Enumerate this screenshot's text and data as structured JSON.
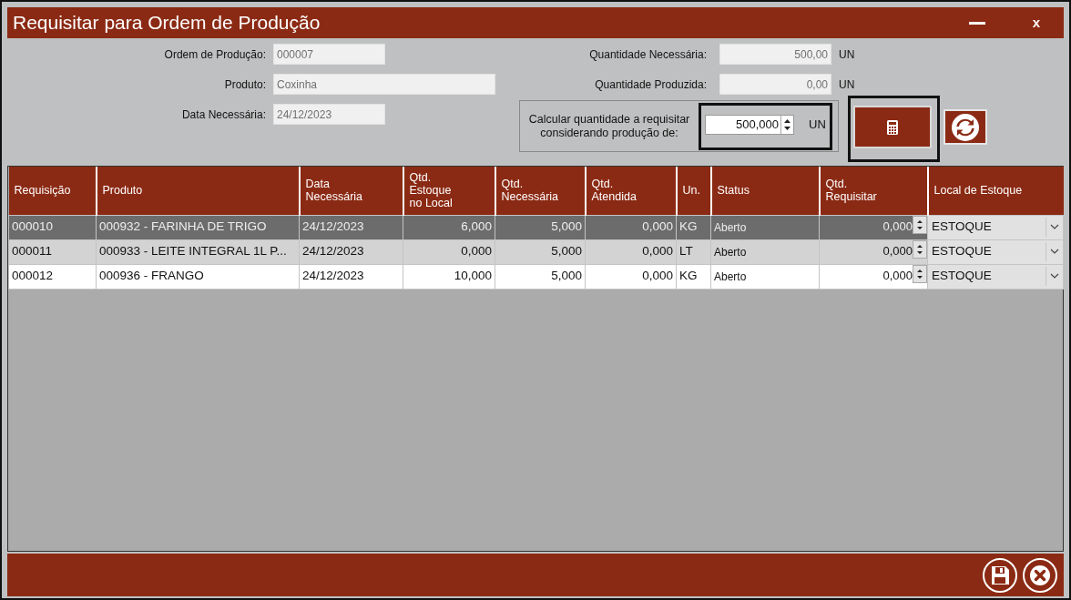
{
  "window": {
    "title": "Requisitar para Ordem de Produção",
    "close_label": "x"
  },
  "form": {
    "left_fields": [
      {
        "label": "Ordem de Produção:",
        "value": "000007",
        "wide": false
      },
      {
        "label": "Produto:",
        "value": "Coxinha",
        "wide": true
      },
      {
        "label": "Data Necessária:",
        "value": "24/12/2023",
        "wide": false
      }
    ],
    "right_fields": [
      {
        "label": "Quantidade Necessária:",
        "value": "500,00",
        "unit": "UN"
      },
      {
        "label": "Quantidade Produzida:",
        "value": "0,00",
        "unit": "UN"
      }
    ],
    "calc": {
      "label": "Calcular quantidade a requisitar\nconsiderando produção de:",
      "value": "500,000",
      "unit": "UN"
    }
  },
  "table": {
    "columns": [
      {
        "label": "Requisição",
        "kind": "text"
      },
      {
        "label": "Produto",
        "kind": "text"
      },
      {
        "label": "Data\nNecessária",
        "kind": "text"
      },
      {
        "label": "Qtd.\nEstoque\nno Local",
        "kind": "number"
      },
      {
        "label": "Qtd.\nNecessária",
        "kind": "number"
      },
      {
        "label": "Qtd.\nAtendida",
        "kind": "number"
      },
      {
        "label": "Un.",
        "kind": "text"
      },
      {
        "label": "Status",
        "kind": "small"
      },
      {
        "label": "Qtd.\nRequisitar",
        "kind": "spin"
      },
      {
        "label": "Local de Estoque",
        "kind": "combo"
      }
    ],
    "rows": [
      {
        "selected": true,
        "cells": [
          "000010",
          "000932 - FARINHA DE TRIGO",
          "24/12/2023",
          "6,000",
          "5,000",
          "0,000",
          "KG",
          "Aberto",
          "0,000",
          "ESTOQUE"
        ]
      },
      {
        "selected": false,
        "cells": [
          "000011",
          "000933 - LEITE INTEGRAL 1L P...",
          "24/12/2023",
          "0,000",
          "5,000",
          "0,000",
          "LT",
          "Aberto",
          "0,000",
          "ESTOQUE"
        ]
      },
      {
        "selected": false,
        "cells": [
          "000012",
          "000936 - FRANGO",
          "24/12/2023",
          "10,000",
          "5,000",
          "0,000",
          "KG",
          "Aberto",
          "0,000",
          "ESTOQUE"
        ]
      }
    ]
  }
}
